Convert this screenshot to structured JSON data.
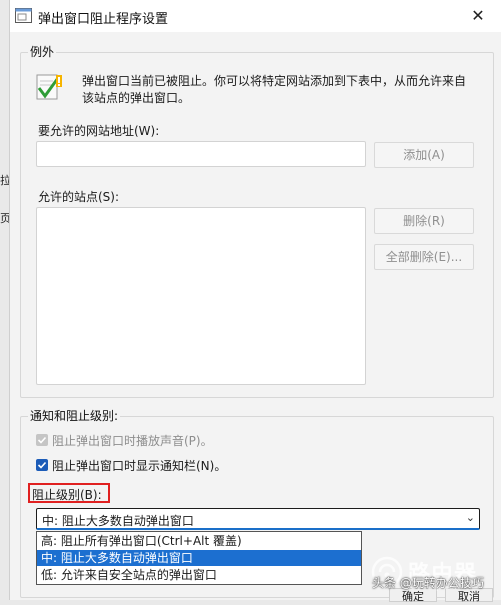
{
  "background": {
    "left_chars": [
      "拉",
      "页"
    ],
    "bottom_buttons": [
      "确定",
      "取消"
    ]
  },
  "dialog": {
    "title": "弹出窗口阻止程序设置",
    "close_glyph": "✕"
  },
  "exceptions": {
    "group_label": "例外",
    "info_text_line1": "弹出窗口当前已被阻止。你可以将特定网站添加到下表中，从而允许来自",
    "info_text_line2": "该站点的弹出窗口。",
    "address_label": "要允许的网站地址(W):",
    "address_value": "",
    "add_button": "添加(A)",
    "allowed_label": "允许的站点(S):",
    "allowed_sites": [],
    "remove_button": "删除(R)",
    "remove_all_button": "全部删除(E)..."
  },
  "notifications": {
    "group_label": "通知和阻止级别:",
    "play_sound_label": "阻止弹出窗口时播放声音(P)。",
    "play_sound_checked": true,
    "play_sound_disabled": true,
    "show_bar_label": "阻止弹出窗口时显示通知栏(N)。",
    "show_bar_checked": true,
    "blocking_level_label": "阻止级别(B):",
    "blocking_level_selected": "中: 阻止大多数自动弹出窗口",
    "blocking_level_options": [
      "高: 阻止所有弹出窗口(Ctrl+Alt 覆盖)",
      "中: 阻止大多数自动弹出窗口",
      "低: 允许来自安全站点的弹出窗口"
    ],
    "highlighted_option_index": 1
  },
  "watermark": {
    "logo_text": "路由器",
    "logo_sub": "luyouqi.com",
    "credit": "头条 @玩转办公技巧"
  },
  "colors": {
    "accent": "#1c6fd0",
    "highlight_box": "#e02020",
    "dialog_bg": "#f3f3f3"
  }
}
